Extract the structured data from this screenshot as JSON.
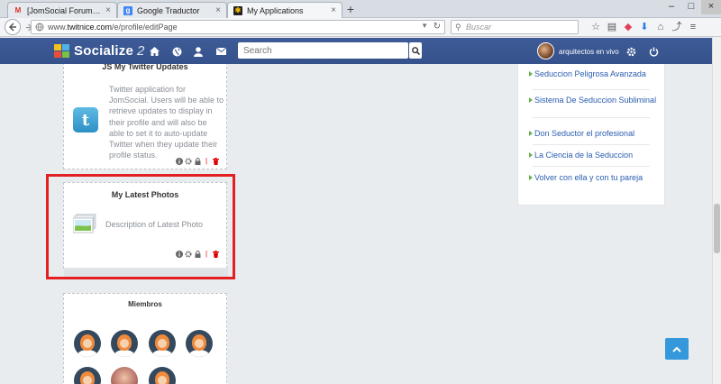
{
  "browser": {
    "tabs": [
      {
        "label": "[JomSocial Forum] hello (...",
        "icon": "gmail-icon"
      },
      {
        "label": "Google Traductor",
        "icon": "translate-icon"
      },
      {
        "label": "My Applications",
        "icon": "joomla-icon"
      }
    ],
    "url_prefix": "www.",
    "url_domain": "twitnice.com",
    "url_path": "/e/profile/editPage",
    "search_placeholder": "Buscar"
  },
  "site": {
    "logo_word": "Socialize",
    "logo_version": "2",
    "search_placeholder": "Search",
    "user_name": "arquitectos en vivo",
    "nav_icons": [
      "home-icon",
      "globe-icon",
      "user-icon",
      "mail-icon"
    ]
  },
  "apps": {
    "twitter": {
      "title": "JS My Twitter Updates",
      "description": "Twitter application for JomSocial. Users will be able to retrieve updates to display in their profile and will also be able to set it to auto-update Twitter when they update their profile status."
    },
    "photos": {
      "title": "My Latest Photos",
      "description": "Description of Latest Photo"
    },
    "members": {
      "title": "Miembros"
    }
  },
  "related_links": [
    "Seduccion Peligrosa Avanzada",
    "Sistema De Seduccion Subliminal",
    "Don Seductor el profesional",
    "La Ciencia de la Seduccion",
    "Volver con ella y con tu pareja"
  ],
  "colors": {
    "header": "#3b5998",
    "highlight": "#e41f23",
    "link": "#2a5db0",
    "scroll_button": "#3498db"
  }
}
